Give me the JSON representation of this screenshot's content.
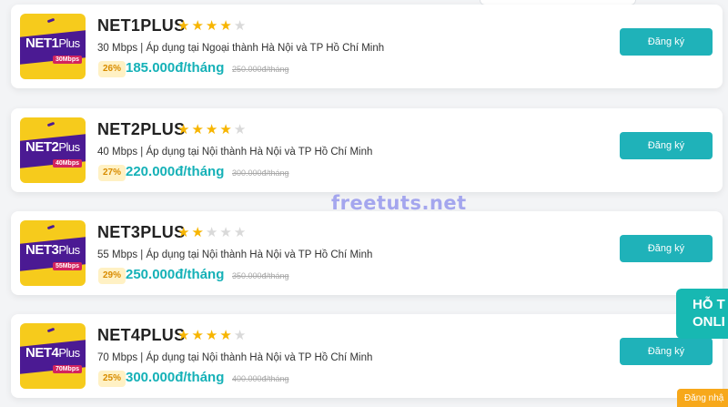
{
  "colors": {
    "accent": "#1fb2b9",
    "price": "#15b1b7",
    "star": "#f7b500",
    "logo_bg": "#f6cb1c",
    "logo_band": "#4b1a93"
  },
  "packages": [
    {
      "name": "NET1PLUS",
      "logo_main": "NET1",
      "logo_plus": "Plus",
      "logo_speed": "30Mbps",
      "rating": 4,
      "desc": "30 Mbps | Áp dụng tại Ngoại thành Hà Nội và TP Hồ Chí Minh",
      "discount": "26%",
      "price": "185.000đ/tháng",
      "old_price": "250.000đ/tháng",
      "button": "Đăng ký"
    },
    {
      "name": "NET2PLUS",
      "logo_main": "NET2",
      "logo_plus": "Plus",
      "logo_speed": "40Mbps",
      "rating": 4,
      "desc": "40 Mbps | Áp dụng tại Nội thành Hà Nội và TP Hồ Chí Minh",
      "discount": "27%",
      "price": "220.000đ/tháng",
      "old_price": "300.000đ/tháng",
      "button": "Đăng ký"
    },
    {
      "name": "NET3PLUS",
      "logo_main": "NET3",
      "logo_plus": "Plus",
      "logo_speed": "55Mbps",
      "rating": 2,
      "desc": "55 Mbps | Áp dụng tại Nội thành Hà Nội và TP Hồ Chí Minh",
      "discount": "29%",
      "price": "250.000đ/tháng",
      "old_price": "350.000đ/tháng",
      "button": "Đăng ký"
    },
    {
      "name": "NET4PLUS",
      "logo_main": "NET4",
      "logo_plus": "Plus",
      "logo_speed": "70Mbps",
      "rating": 4,
      "desc": "70 Mbps | Áp dụng tại Nội thành Hà Nội và TP Hồ Chí Minh",
      "discount": "25%",
      "price": "300.000đ/tháng",
      "old_price": "400.000đ/tháng",
      "button": "Đăng ký"
    }
  ],
  "watermark": "freetuts.net",
  "support_widget": {
    "line1": "HỖ T",
    "line2": "ONLI"
  },
  "register_tab": "Đăng nhậ"
}
